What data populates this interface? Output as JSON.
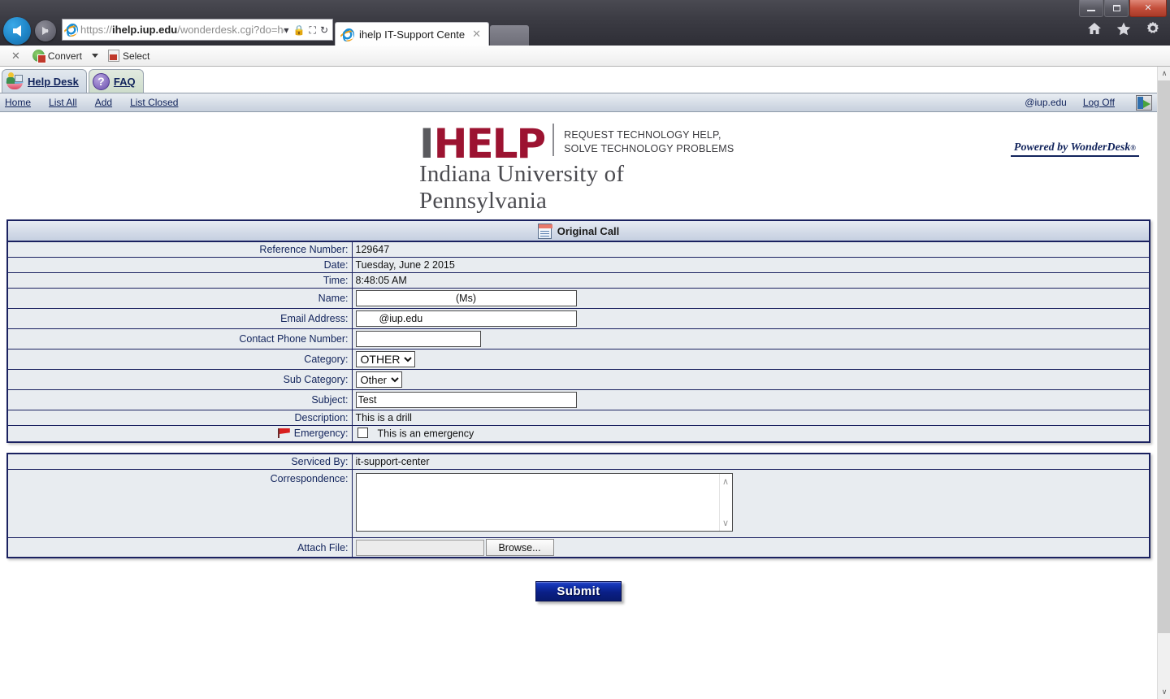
{
  "browser": {
    "url_scheme": "https://",
    "url_host": "ihelp.iup.edu",
    "url_path": "/wonderdesk.cgi?do=hd_home&q",
    "tab_title": "ihelp IT-Support Center",
    "tab_close_label": "✕",
    "icons": {
      "back": "back-arrow-icon",
      "forward": "forward-arrow-icon",
      "ie_logo": "internet-explorer-icon",
      "lock": "🔒",
      "compat": "⛶",
      "refresh": "↻",
      "dropdown": "▾",
      "home": "home-icon",
      "favorites": "star-icon",
      "tools": "gear-icon"
    },
    "window_controls": {
      "minimize": "Minimize",
      "maximize": "Maximize",
      "close": "✕"
    }
  },
  "pdf_toolbar": {
    "close_label": "✕",
    "convert_label": "Convert",
    "dropdown_label": "▾",
    "select_label": "Select"
  },
  "app_tabs": [
    {
      "label": "Help Desk",
      "icon": "helpdesk-icon",
      "active": true
    },
    {
      "label": "FAQ",
      "icon": "question-mark-icon",
      "active": false
    }
  ],
  "powered_by": {
    "text": "Powered by WonderDesk",
    "registered": "®"
  },
  "sub_nav": {
    "links": [
      "Home",
      "List All",
      "Add",
      "List Closed"
    ],
    "user": "@iup.edu",
    "logoff_label": "Log Off",
    "logoff_icon": "logoff-door-icon"
  },
  "logo": {
    "letter_i": "I",
    "word_help": "HELP",
    "tagline_line1": "REQUEST TECHNOLOGY HELP,",
    "tagline_line2": "SOLVE TECHNOLOGY PROBLEMS",
    "university": "Indiana University of Pennsylvania",
    "color_i": "#5a5a5e",
    "color_help": "#9c1331"
  },
  "call_panel": {
    "header": "Original Call",
    "header_icon": "document-icon",
    "rows": {
      "reference_number_label": "Reference Number:",
      "reference_number_value": "129647",
      "date_label": "Date:",
      "date_value": "Tuesday, June 2 2015",
      "time_label": "Time:",
      "time_value": "8:48:05 AM",
      "name_label": "Name:",
      "name_value": "(Ms)",
      "email_label": "Email Address:",
      "email_value": "@iup.edu",
      "phone_label": "Contact Phone Number:",
      "phone_value": "",
      "category_label": "Category:",
      "category_value": "OTHER",
      "category_options": [
        "OTHER"
      ],
      "subcategory_label": "Sub Category:",
      "subcategory_value": "Other",
      "subcategory_options": [
        "Other"
      ],
      "subject_label": "Subject:",
      "subject_value": "Test",
      "description_label": "Description:",
      "description_value": "This is a drill",
      "emergency_label": "Emergency:",
      "emergency_icon": "red-flag-icon",
      "emergency_checkbox_label": "This is an emergency",
      "emergency_checked": false
    }
  },
  "service_panel": {
    "serviced_by_label": "Serviced By:",
    "serviced_by_value": "it-support-center",
    "correspondence_label": "Correspondence:",
    "correspondence_value": "",
    "attach_file_label": "Attach File:",
    "attach_file_value": "",
    "browse_label": "Browse...",
    "scroll_up": "∧",
    "scroll_down": "∨"
  },
  "submit": {
    "label": "Submit"
  },
  "scrollbar": {
    "up_arrow": "∧",
    "down_arrow": "∨"
  },
  "colors": {
    "row_bg": "#e8ecf0",
    "border_navy": "#1a2160",
    "label_text": "#12245c",
    "header_grad_top": "#e6eaf2",
    "header_grad_bottom": "#c5cfe0",
    "submit_blue": "#0a1f86"
  }
}
